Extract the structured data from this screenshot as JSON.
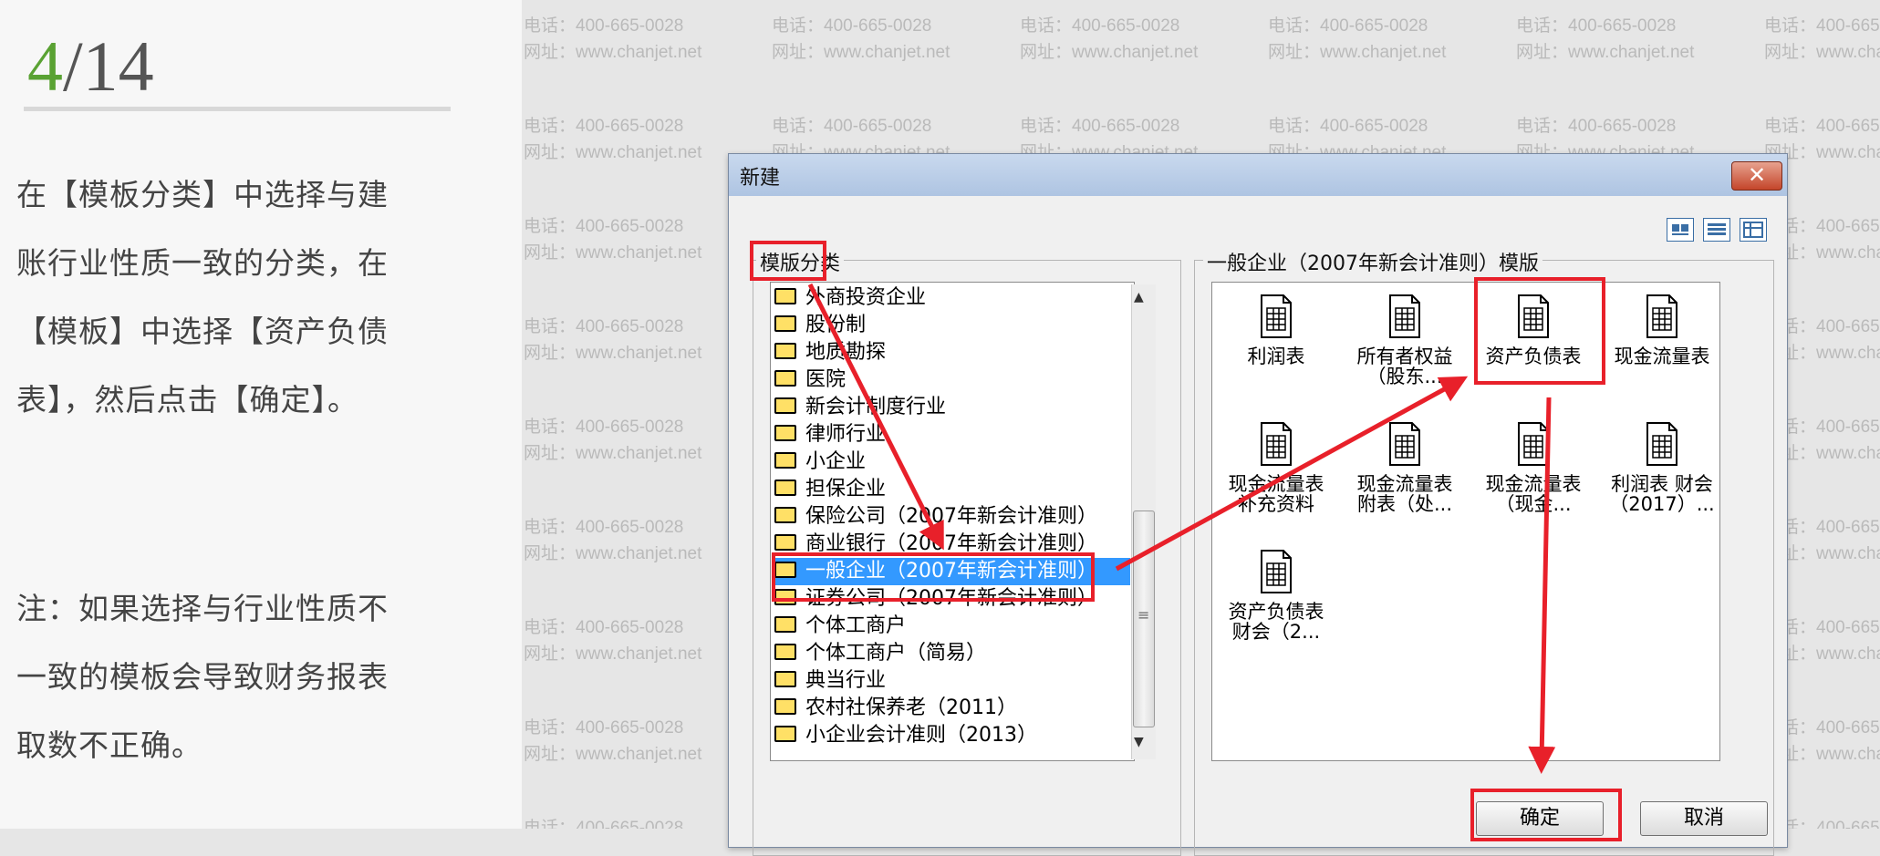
{
  "slide": {
    "current_page": "4",
    "total_pages": "/14",
    "instruction": "在【模板分类】中选择与建账行业性质一致的分类，在【模板】中选择【资产负债表】，然后点击【确定】。",
    "note": "注：如果选择与行业性质不一致的模板会导致财务报表取数不正确。"
  },
  "watermark": {
    "phone": "电话：400-665-0028",
    "site": "网址：www.chanjet.net"
  },
  "dialog": {
    "title": "新建",
    "close_label": "✕",
    "category_group_label": "模版分类",
    "template_group_label": "一般企业（2007年新会计准则）模版",
    "categories": [
      "外商投资企业",
      "股份制",
      "地质勘探",
      "医院",
      "新会计制度行业",
      "律师行业",
      "小企业",
      "担保企业",
      "保险公司（2007年新会计准则）",
      "商业银行（2007年新会计准则）",
      "一般企业（2007年新会计准则）",
      "证券公司（2007年新会计准则）",
      "个体工商户",
      "个体工商户（简易）",
      "典当行业",
      "农村社保养老（2011）",
      "小企业会计准则（2013）"
    ],
    "selected_category": "一般企业（2007年新会计准则）",
    "templates": [
      {
        "line1": "利润表",
        "line2": ""
      },
      {
        "line1": "所有者权益",
        "line2": "（股东..."
      },
      {
        "line1": "资产负债表",
        "line2": ""
      },
      {
        "line1": "现金流量表",
        "line2": ""
      },
      {
        "line1": "现金流量表",
        "line2": "补充资料"
      },
      {
        "line1": "现金流量表",
        "line2": "附表（处..."
      },
      {
        "line1": "现金流量表",
        "line2": "（现金..."
      },
      {
        "line1": "利润表 财会",
        "line2": "（2017）..."
      },
      {
        "line1": "资产负债表",
        "line2": "财会（2..."
      }
    ],
    "selected_template": "资产负债表",
    "ok_label": "确定",
    "cancel_label": "取消"
  },
  "colors": {
    "accent_green": "#5aa233",
    "annotation_red": "#e8202a",
    "selection_blue": "#3399ff"
  }
}
